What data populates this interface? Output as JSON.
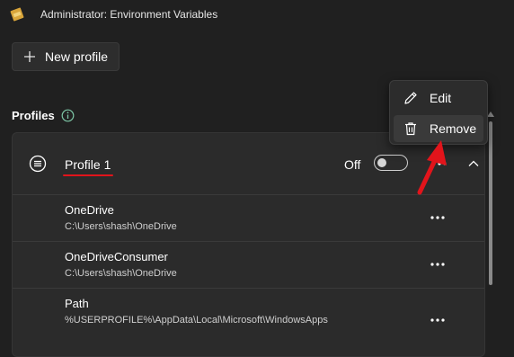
{
  "window": {
    "title": "Administrator: Environment Variables"
  },
  "toolbar": {
    "new_profile_label": "New profile"
  },
  "profiles_section": {
    "title": "Profiles",
    "profile": {
      "name": "Profile 1",
      "toggle_label": "Off",
      "toggle_on": false,
      "variables": [
        {
          "name": "OneDrive",
          "value": "C:\\Users\\shash\\OneDrive"
        },
        {
          "name": "OneDriveConsumer",
          "value": "C:\\Users\\shash\\OneDrive"
        },
        {
          "name": "Path",
          "value": "%USERPROFILE%\\AppData\\Local\\Microsoft\\WindowsApps"
        }
      ]
    }
  },
  "context_menu": {
    "items": [
      {
        "label": "Edit",
        "icon": "pencil-icon"
      },
      {
        "label": "Remove",
        "icon": "trash-icon"
      }
    ]
  },
  "colors": {
    "background": "#202020",
    "panel": "#2b2b2b",
    "underline_annotation": "#e2141b",
    "arrow_annotation": "#e2141b"
  }
}
